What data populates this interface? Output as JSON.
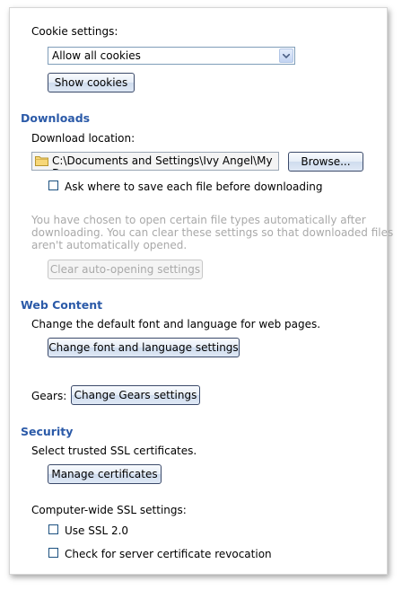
{
  "cookies": {
    "label": "Cookie settings:",
    "selected": "Allow all cookies",
    "show_button": "Show cookies"
  },
  "downloads": {
    "heading": "Downloads",
    "location_label": "Download location:",
    "path": "C:\\Documents and Settings\\Ivy Angel\\My Doc",
    "browse_button": "Browse...",
    "ask_checkbox_label": "Ask where to save each file before downloading",
    "ask_checked": false,
    "auto_open_line1": "You have chosen to open certain file types automatically after",
    "auto_open_line2": "downloading. You can clear these settings so that downloaded files",
    "auto_open_line3": "aren't automatically opened.",
    "clear_button": "Clear auto-opening settings"
  },
  "web_content": {
    "heading": "Web Content",
    "description": "Change the default font and language for web pages.",
    "font_button": "Change font and language settings"
  },
  "gears": {
    "label": "Gears:",
    "button": "Change Gears settings"
  },
  "security": {
    "heading": "Security",
    "ssl_description": "Select trusted SSL certificates.",
    "manage_button": "Manage certificates",
    "computer_wide_label": "Computer-wide SSL settings:",
    "ssl2_label": "Use SSL 2.0",
    "ssl2_checked": false,
    "revocation_label": "Check for server certificate revocation",
    "revocation_checked": false
  },
  "icons": [
    "chevron-down-icon",
    "folder-icon"
  ],
  "colors": {
    "heading": "#2b5aa8",
    "disabled_text": "#a9a9a9"
  }
}
